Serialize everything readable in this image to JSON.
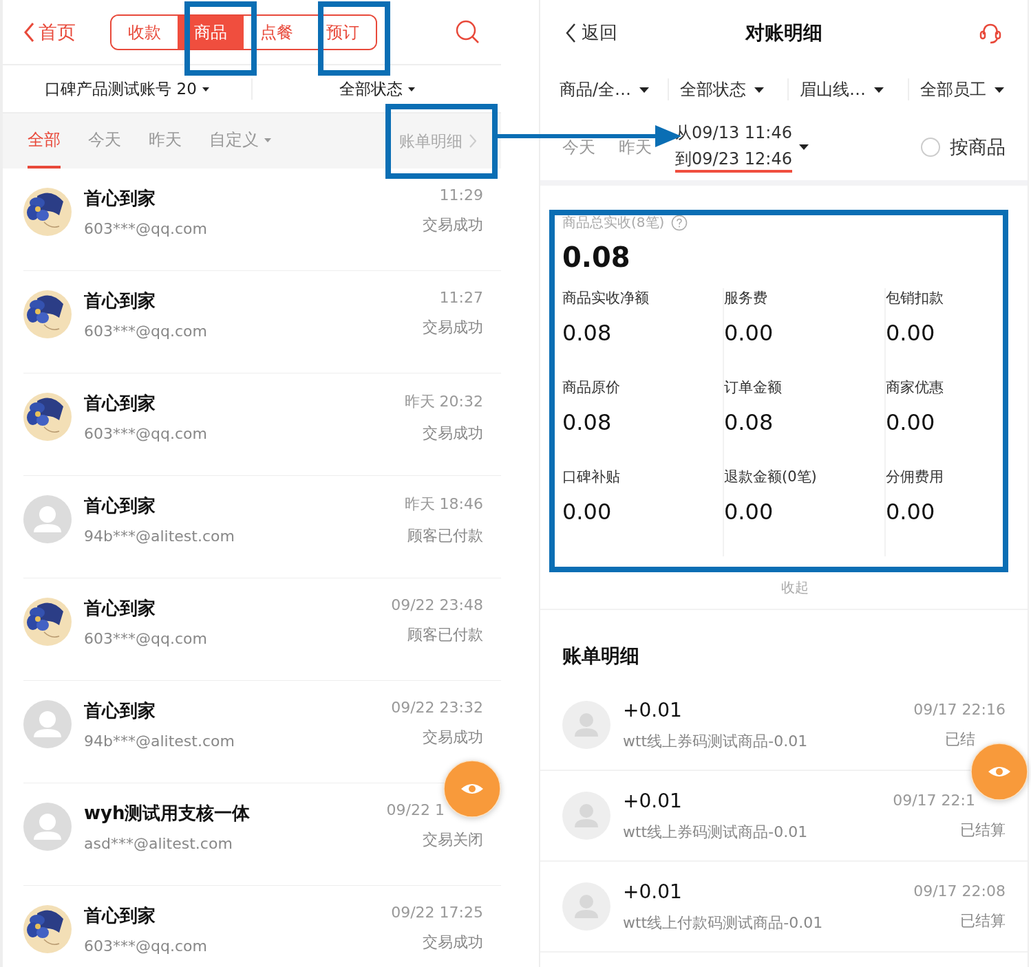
{
  "left_screen": {
    "back_label": "首页",
    "segments": [
      {
        "label": "收款",
        "selected": false
      },
      {
        "label": "商品",
        "selected": true
      },
      {
        "label": "点餐",
        "selected": false
      },
      {
        "label": "预订",
        "selected": false
      }
    ],
    "filters": [
      "口碑产品测试账号 20",
      "全部状态"
    ],
    "date_tabs": [
      {
        "label": "全部",
        "selected": true,
        "kind": "plain"
      },
      {
        "label": "今天",
        "selected": false,
        "kind": "plain"
      },
      {
        "label": "昨天",
        "selected": false,
        "kind": "plain"
      },
      {
        "label": "自定义",
        "selected": false,
        "kind": "dropdown"
      }
    ],
    "bill_link": "账单明细",
    "orders": [
      {
        "kind": "picture",
        "name": "首心到家",
        "account": "603***@qq.com",
        "time": "11:29",
        "status": "交易成功"
      },
      {
        "kind": "picture",
        "name": "首心到家",
        "account": "603***@qq.com",
        "time": "11:27",
        "status": "交易成功"
      },
      {
        "kind": "picture",
        "name": "首心到家",
        "account": "603***@qq.com",
        "time": "昨天 20:32",
        "status": "交易成功"
      },
      {
        "kind": "default",
        "name": "首心到家",
        "account": "94b***@alitest.com",
        "time": "昨天 18:46",
        "status": "顾客已付款"
      },
      {
        "kind": "picture",
        "name": "首心到家",
        "account": "603***@qq.com",
        "time": "09/22 23:48",
        "status": "顾客已付款"
      },
      {
        "kind": "default",
        "name": "首心到家",
        "account": "94b***@alitest.com",
        "time": "09/22 23:32",
        "status": "交易成功"
      },
      {
        "kind": "default",
        "name": "wyh测试用支核一体",
        "account": "asd***@alitest.com",
        "time": "09/22 1",
        "status": "交易关闭"
      },
      {
        "kind": "picture",
        "name": "首心到家",
        "account": "603***@qq.com",
        "time": "09/22 17:25",
        "status": "交易成功"
      }
    ]
  },
  "right_screen": {
    "back_label": "返回",
    "title": "对账明细",
    "filters": [
      "商品/全…",
      "全部状态",
      "眉山线…",
      "全部员工"
    ],
    "date_tabs": [
      {
        "label": "今天",
        "selected": false
      },
      {
        "label": "昨天",
        "selected": false
      }
    ],
    "date_range": {
      "from": "从09/13 11:46",
      "to": "到09/23 12:46",
      "selected": true
    },
    "by_product": {
      "label": "按商品",
      "checked": false
    },
    "summary": {
      "title": "商品总实收(8笔)",
      "total": "0.08",
      "metrics": [
        {
          "label": "商品实收净额",
          "value": "0.08"
        },
        {
          "label": "服务费",
          "value": "0.00"
        },
        {
          "label": "包销扣款",
          "value": "0.00"
        },
        {
          "label": "商品原价",
          "value": "0.08"
        },
        {
          "label": "订单金额",
          "value": "0.08"
        },
        {
          "label": "商家优惠",
          "value": "0.00"
        },
        {
          "label": "口碑补贴",
          "value": "0.00"
        },
        {
          "label": "退款金额(0笔)",
          "value": "0.00"
        },
        {
          "label": "分佣费用",
          "value": "0.00"
        }
      ],
      "collapse_label": "收起"
    },
    "bills_title": "账单明细",
    "bills": [
      {
        "amount": "+0.01",
        "item": "wtt线上券码测试商品-0.01",
        "time": "09/17 22:16",
        "status": "已结"
      },
      {
        "amount": "+0.01",
        "item": "wtt线上券码测试商品-0.01",
        "time": "09/17 22:1",
        "status": "已结算"
      },
      {
        "amount": "+0.01",
        "item": "wtt线上付款码测试商品-0.01",
        "time": "09/17 22:08",
        "status": "已结算"
      }
    ]
  }
}
